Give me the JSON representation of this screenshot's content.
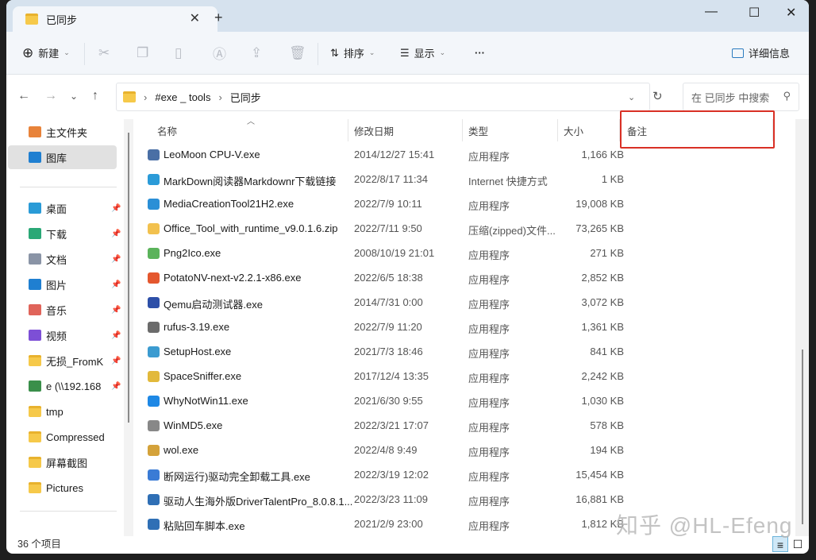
{
  "window": {
    "tab_title": "已同步",
    "new_tab": "+",
    "close_tab": "✕",
    "minimize": "—",
    "maximize": "☐",
    "close": "✕"
  },
  "toolbar": {
    "new": "新建",
    "sort": "排序",
    "view": "显示",
    "more": "···",
    "details": "详细信息"
  },
  "address": {
    "crumbs": [
      "#exe _ tools",
      "已同步"
    ],
    "search_placeholder": "在 已同步 中搜索"
  },
  "sidebar": {
    "items": [
      {
        "label": "主文件夹",
        "icon": "home-icon",
        "pin": false
      },
      {
        "label": "图库",
        "icon": "gallery-icon",
        "pin": false,
        "selected": true
      },
      {
        "label": "桌面",
        "icon": "desktop-icon",
        "pin": true
      },
      {
        "label": "下载",
        "icon": "download-icon",
        "pin": true
      },
      {
        "label": "文档",
        "icon": "document-icon",
        "pin": true
      },
      {
        "label": "图片",
        "icon": "pictures-icon",
        "pin": true
      },
      {
        "label": "音乐",
        "icon": "music-icon",
        "pin": true
      },
      {
        "label": "视频",
        "icon": "video-icon",
        "pin": true
      },
      {
        "label": "无损_FromK",
        "icon": "folder-icon",
        "pin": true
      },
      {
        "label": "e (\\\\192.168",
        "icon": "network-drive-icon",
        "pin": true
      },
      {
        "label": "tmp",
        "icon": "folder-icon",
        "pin": false
      },
      {
        "label": "Compressed",
        "icon": "folder-icon",
        "pin": false
      },
      {
        "label": "屏幕截图",
        "icon": "folder-icon",
        "pin": false
      },
      {
        "label": "Pictures",
        "icon": "folder-icon",
        "pin": false
      }
    ]
  },
  "columns": {
    "name": "名称",
    "date": "修改日期",
    "type": "类型",
    "size": "大小",
    "note": "备注"
  },
  "files": [
    {
      "name": "LeoMoon CPU-V.exe",
      "date": "2014/12/27 15:41",
      "type": "应用程序",
      "size": "1,166 KB",
      "color": "#4a6fa5"
    },
    {
      "name": "MarkDown阅读器Markdownr下载链接",
      "date": "2022/8/17 11:34",
      "type": "Internet 快捷方式",
      "size": "1 KB",
      "color": "#2b9bd8"
    },
    {
      "name": "MediaCreationTool21H2.exe",
      "date": "2022/7/9 10:11",
      "type": "应用程序",
      "size": "19,008 KB",
      "color": "#2a8fd6"
    },
    {
      "name": "Office_Tool_with_runtime_v9.0.1.6.zip",
      "date": "2022/7/11 9:50",
      "type": "压缩(zipped)文件...",
      "size": "73,265 KB",
      "color": "#f2c14e"
    },
    {
      "name": "Png2Ico.exe",
      "date": "2008/10/19 21:01",
      "type": "应用程序",
      "size": "271 KB",
      "color": "#5bb35b"
    },
    {
      "name": "PotatoNV-next-v2.2.1-x86.exe",
      "date": "2022/6/5 18:38",
      "type": "应用程序",
      "size": "2,852 KB",
      "color": "#e4572e"
    },
    {
      "name": "Qemu启动测试器.exe",
      "date": "2014/7/31 0:00",
      "type": "应用程序",
      "size": "3,072 KB",
      "color": "#2d4fa8"
    },
    {
      "name": "rufus-3.19.exe",
      "date": "2022/7/9 11:20",
      "type": "应用程序",
      "size": "1,361 KB",
      "color": "#6b6b6b"
    },
    {
      "name": "SetupHost.exe",
      "date": "2021/7/3 18:46",
      "type": "应用程序",
      "size": "841 KB",
      "color": "#3b9bd0"
    },
    {
      "name": "SpaceSniffer.exe",
      "date": "2017/12/4 13:35",
      "type": "应用程序",
      "size": "2,242 KB",
      "color": "#e2b93b"
    },
    {
      "name": "WhyNotWin11.exe",
      "date": "2021/6/30 9:55",
      "type": "应用程序",
      "size": "1,030 KB",
      "color": "#1e88e5"
    },
    {
      "name": "WinMD5.exe",
      "date": "2022/3/21 17:07",
      "type": "应用程序",
      "size": "578 KB",
      "color": "#888888"
    },
    {
      "name": "wol.exe",
      "date": "2022/4/8 9:49",
      "type": "应用程序",
      "size": "194 KB",
      "color": "#d4a23a"
    },
    {
      "name": "断网运行)驱动完全卸载工具.exe",
      "date": "2022/3/19 12:02",
      "type": "应用程序",
      "size": "15,454 KB",
      "color": "#3a7bd5"
    },
    {
      "name": "驱动人生海外版DriverTalentPro_8.0.8.1...",
      "date": "2022/3/23 11:09",
      "type": "应用程序",
      "size": "16,881 KB",
      "color": "#2f6fb5"
    },
    {
      "name": "粘贴回车脚本.exe",
      "date": "2021/2/9 23:00",
      "type": "应用程序",
      "size": "1,812 KB",
      "color": "#2f6fb5"
    }
  ],
  "status": {
    "count": "36 个项目"
  },
  "watermark": "知乎 @HL-Efeng"
}
